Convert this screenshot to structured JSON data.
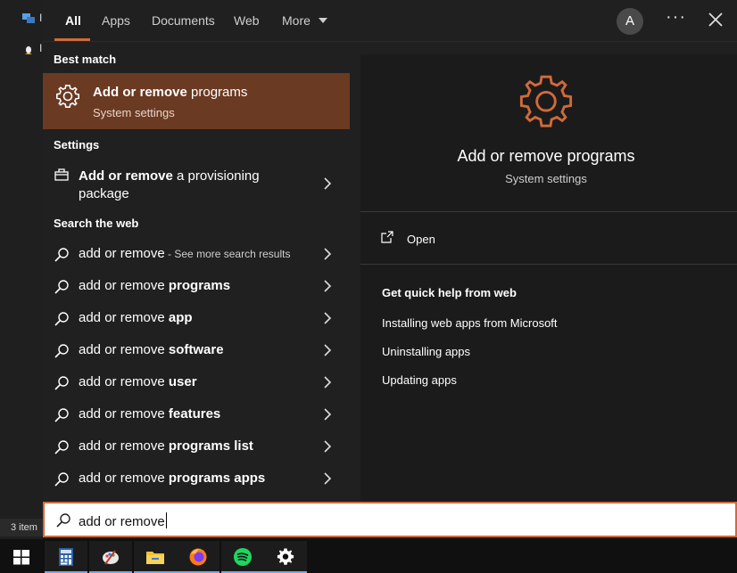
{
  "desktop": {
    "status_text": "3 item",
    "icon_labels": [
      "I",
      "I"
    ]
  },
  "tabs": {
    "items": [
      "All",
      "Apps",
      "Documents",
      "Web",
      "More"
    ],
    "active": "All",
    "avatar_letter": "A",
    "more_menu": "···"
  },
  "results": {
    "best_match_header": "Best match",
    "best_match": {
      "title_bold": "Add or remove",
      "title_rest": " programs",
      "subtitle": "System settings"
    },
    "settings_header": "Settings",
    "settings_item": {
      "bold": "Add or remove",
      "rest_line1": " a provisioning",
      "rest_line2": "package"
    },
    "web_header": "Search the web",
    "web_items": [
      {
        "plain": "add or remove",
        "bold": "",
        "extra": " - See more search results"
      },
      {
        "plain": "add or remove ",
        "bold": "programs",
        "extra": ""
      },
      {
        "plain": "add or remove ",
        "bold": "app",
        "extra": ""
      },
      {
        "plain": "add or remove ",
        "bold": "software",
        "extra": ""
      },
      {
        "plain": "add or remove ",
        "bold": "user",
        "extra": ""
      },
      {
        "plain": "add or remove ",
        "bold": "features",
        "extra": ""
      },
      {
        "plain": "add or remove ",
        "bold": "programs list",
        "extra": ""
      },
      {
        "plain": "add or remove ",
        "bold": "programs apps",
        "extra": ""
      }
    ]
  },
  "preview": {
    "title": "Add or remove programs",
    "subtitle": "System settings",
    "open_label": "Open",
    "quick_help_header": "Get quick help from web",
    "links": [
      "Installing web apps from Microsoft",
      "Uninstalling apps",
      "Updating apps"
    ]
  },
  "search": {
    "value": "add or remove"
  },
  "taskbar": {
    "apps": [
      "windows-start",
      "calculator",
      "paint",
      "file-explorer",
      "firefox",
      "spotify",
      "settings"
    ]
  },
  "colors": {
    "accent": "#d06a3a",
    "selected_bg": "#6b3a22",
    "panel_bg": "#202020",
    "preview_bg": "#1b1b1b"
  }
}
